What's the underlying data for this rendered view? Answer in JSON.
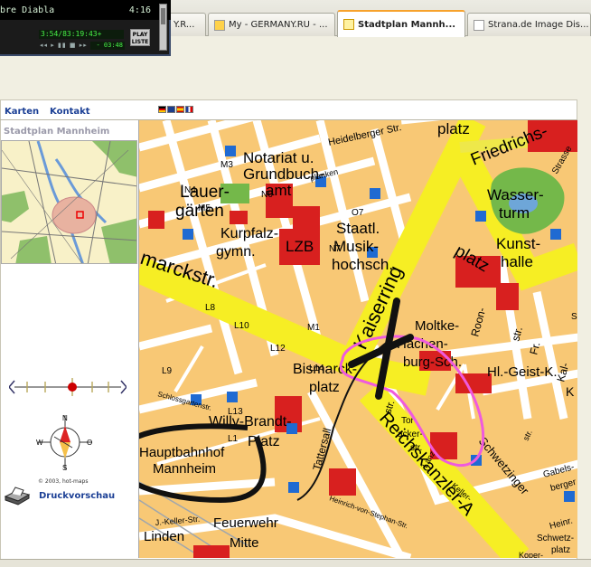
{
  "tabs": [
    {
      "label": "Y.R..."
    },
    {
      "label": "My - GERMANY.RU - ..."
    },
    {
      "label": "Stadtplan Mannh..."
    },
    {
      "label": "Strana.de Image Dis..."
    }
  ],
  "player": {
    "track": "bre Diabla",
    "duration": "4:16",
    "time": "3:54/83:19:43+",
    "remaining": "- 03:48",
    "controls": "◂◂ ▸ ▮▮ ■ ▸▸ ▴",
    "playlist_label": "PLAY LISTE"
  },
  "nav": {
    "karten": "Karten",
    "kontakt": "Kontakt"
  },
  "sidebar": {
    "title": "Stadtplan Mannheim",
    "copyright": "© 2003, hot-maps",
    "print_label": "Druckvorschau",
    "compass": {
      "n": "N",
      "s": "S",
      "w": "W",
      "o": "O"
    }
  },
  "map_labels": {
    "heidelberger": "Heidelberger Str.",
    "friedrichs": "Friedrichs-",
    "strasse": "Strasse",
    "notariat1": "Notariat u.",
    "notariat2": "Grundbuch-",
    "notariat3": "amt",
    "lauer1": "Lauer-",
    "lauer2": "gärten",
    "kurpfalz1": "Kurpfalz-",
    "kurpfalz2": "gymn.",
    "lzb": "LZB",
    "staatl1": "Staatl.",
    "staatl2": "Musik-",
    "staatl3": "hochsch.",
    "kaiserring": "Kaiserring",
    "wasser1": "Wasser-",
    "wasser2": "turm",
    "kunst1": "Kunst-",
    "kunst2": "halle",
    "platz1": "platz",
    "platz2": "platz",
    "marckstr": "marckstr.",
    "moltke1": "Moltke-",
    "moltke2": "Hachen-",
    "moltke3": "burg-Sch.",
    "hlgeist": "Hl.-Geist-K.",
    "bismarck1": "Bismarck-",
    "bismarck2": "platz",
    "willy1": "Willy-Brandt-",
    "willy2": "Platz",
    "hbf1": "Hauptbahnhof",
    "hbf2": "Mannheim",
    "reichskanzler": "Reichskanzler-A",
    "tattersall": "Tattersall",
    "schwetzinger": "Schwetzinger",
    "feuerwehr1": "Feuerwehr",
    "feuerwehr2": "Mitte",
    "linden": "Linden",
    "jkeller": "J.-Keller-Str.",
    "heinrich": "Heinrich-von-Stephan-Str.",
    "schlossgarten": "Schlossgartenstr.",
    "planken": "planken",
    "roon": "Roon-",
    "kal": "Kal-",
    "fr": "Fr.",
    "str1": "str.",
    "str2": "str.",
    "str3": "str.",
    "tor1": "Tor-",
    "tor2": "acker-",
    "tor3": "str.",
    "keller": "Keller-",
    "lanz": "Lanz-",
    "gabels": "Gabels-",
    "berger": "berger",
    "heinr": "Heinr.",
    "koper": "Koper-",
    "schwetz2": "Schwetz-",
    "schwetz3": "platz",
    "n4": "N4",
    "m5": "M5",
    "m3": "M3",
    "n6": "N6",
    "o7": "O7",
    "n7": "N7",
    "l8": "L8",
    "l10": "L10",
    "l12": "L12",
    "l14": "L14",
    "l9": "L9",
    "l13": "L13",
    "l1": "L1",
    "m1": "M1",
    "k": "K",
    "s": "S"
  }
}
